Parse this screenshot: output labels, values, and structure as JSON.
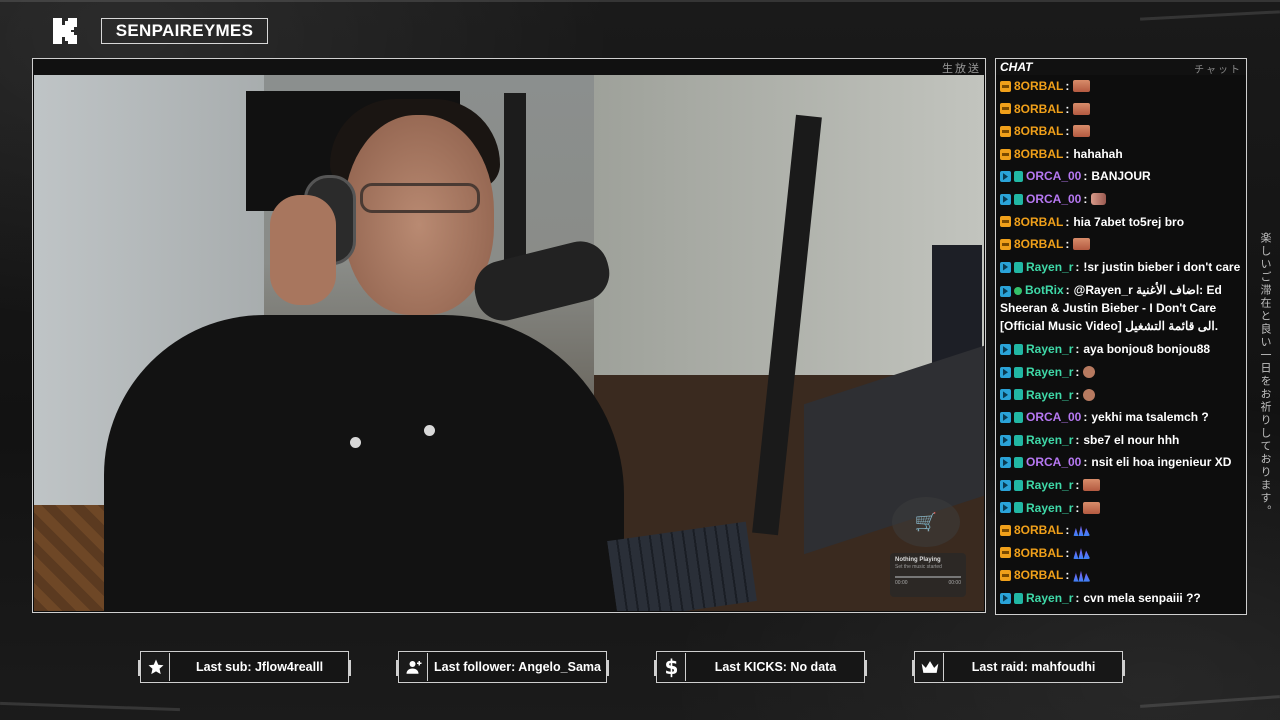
{
  "header": {
    "channel_name": "SENPAIREYMES"
  },
  "video": {
    "live_label": "生放送",
    "music_player": {
      "title": "Nothing Playing",
      "subtitle": "Set the music started",
      "time_start": "00:00",
      "time_end": "00:00"
    }
  },
  "chat": {
    "title": "CHAT",
    "title_jp": "チャット",
    "messages": [
      {
        "user": "8ORBAL",
        "color": "#f0a01a",
        "badges": [
          "sub"
        ],
        "text": "",
        "emote": "face"
      },
      {
        "user": "8ORBAL",
        "color": "#f0a01a",
        "badges": [
          "sub"
        ],
        "text": "",
        "emote": "face"
      },
      {
        "user": "8ORBAL",
        "color": "#f0a01a",
        "badges": [
          "sub"
        ],
        "text": "",
        "emote": "face"
      },
      {
        "user": "8ORBAL",
        "color": "#f0a01a",
        "badges": [
          "sub"
        ],
        "text": "hahahah",
        "emote": ""
      },
      {
        "user": "ORCA_00",
        "color": "#b678f2",
        "badges": [
          "kick",
          "gift"
        ],
        "text": "BANJOUR",
        "emote": ""
      },
      {
        "user": "ORCA_00",
        "color": "#b678f2",
        "badges": [
          "kick",
          "gift"
        ],
        "text": "",
        "emote": "hands"
      },
      {
        "user": "8ORBAL",
        "color": "#f0a01a",
        "badges": [
          "sub"
        ],
        "text": "hia 7abet to5rej bro",
        "emote": ""
      },
      {
        "user": "8ORBAL",
        "color": "#f0a01a",
        "badges": [
          "sub"
        ],
        "text": "",
        "emote": "face"
      },
      {
        "user": "Rayen_r",
        "color": "#3fd9a8",
        "badges": [
          "kick",
          "gift"
        ],
        "text": "!sr justin bieber i don't care",
        "emote": ""
      },
      {
        "user": "BotRix",
        "color": "#3fd9a8",
        "badges": [
          "kick",
          "bot"
        ],
        "text": "@Rayen_r اضاف الأغنية: Ed Sheeran & Justin Bieber - I Don't Care [Official Music Video] الى قائمة التشغيل.",
        "emote": "",
        "multi": true
      },
      {
        "user": "Rayen_r",
        "color": "#3fd9a8",
        "badges": [
          "kick",
          "gift"
        ],
        "text": "aya bonjou8 bonjou88",
        "emote": ""
      },
      {
        "user": "Rayen_r",
        "color": "#3fd9a8",
        "badges": [
          "kick",
          "gift"
        ],
        "text": "",
        "emote": "small"
      },
      {
        "user": "Rayen_r",
        "color": "#3fd9a8",
        "badges": [
          "kick",
          "gift"
        ],
        "text": "",
        "emote": "small"
      },
      {
        "user": "ORCA_00",
        "color": "#b678f2",
        "badges": [
          "kick",
          "gift"
        ],
        "text": "yekhi ma tsalemch ?",
        "emote": ""
      },
      {
        "user": "Rayen_r",
        "color": "#3fd9a8",
        "badges": [
          "kick",
          "gift"
        ],
        "text": "sbe7 el nour hhh",
        "emote": ""
      },
      {
        "user": "ORCA_00",
        "color": "#b678f2",
        "badges": [
          "kick",
          "gift"
        ],
        "text": "nsit eli hoa ingenieur XD",
        "emote": ""
      },
      {
        "user": "Rayen_r",
        "color": "#3fd9a8",
        "badges": [
          "kick",
          "gift"
        ],
        "text": "",
        "emote": "face"
      },
      {
        "user": "Rayen_r",
        "color": "#3fd9a8",
        "badges": [
          "kick",
          "gift"
        ],
        "text": "",
        "emote": "face"
      },
      {
        "user": "8ORBAL",
        "color": "#f0a01a",
        "badges": [
          "sub"
        ],
        "text": "",
        "emote": "dance"
      },
      {
        "user": "8ORBAL",
        "color": "#f0a01a",
        "badges": [
          "sub"
        ],
        "text": "",
        "emote": "dance"
      },
      {
        "user": "8ORBAL",
        "color": "#f0a01a",
        "badges": [
          "sub"
        ],
        "text": "",
        "emote": "dance"
      },
      {
        "user": "Rayen_r",
        "color": "#3fd9a8",
        "badges": [
          "kick",
          "gift"
        ],
        "text": "cvn mela senpaiii ??",
        "emote": ""
      }
    ]
  },
  "side_text": "楽しいご滞在と良い一日をお祈りしております。",
  "stats": {
    "last_sub": "Last sub: Jflow4realll",
    "last_follower": "Last follower: Angelo_Sama",
    "last_kicks": "Last KICKS: No data",
    "last_raid": "Last raid: mahfoudhi"
  },
  "icons": {
    "sub": "star-icon",
    "follower": "user-plus-icon",
    "kicks": "dollar-icon",
    "raid": "crown-icon"
  }
}
